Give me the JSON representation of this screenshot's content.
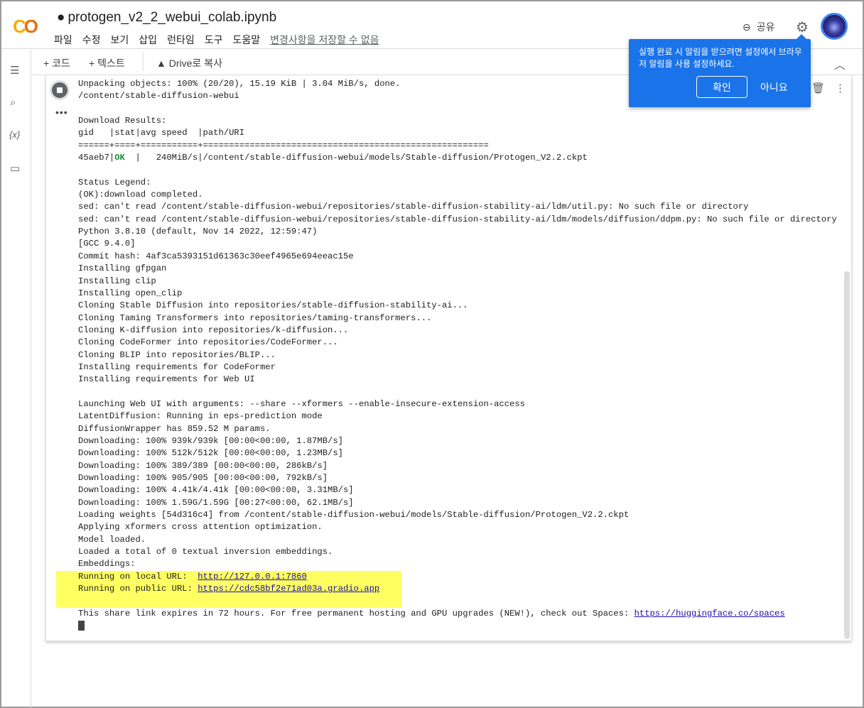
{
  "header": {
    "logo": "CO",
    "title": "protogen_v2_2_webui_colab.ipynb",
    "menu": [
      "파일",
      "수정",
      "보기",
      "삽입",
      "런타임",
      "도구",
      "도움말"
    ],
    "save_status": "변경사항을 저장할 수 없음",
    "share": "공유"
  },
  "toolbar": {
    "add_code": "+ 코드",
    "add_text": "+ 텍스트",
    "copy_drive": "Drive로 복사"
  },
  "popup": {
    "message": "실행 완료 시 알림을 받으려면 설정에서 브라우저 알림을 사용 설정하세요.",
    "confirm": "확인",
    "decline": "아니요"
  },
  "output": {
    "lines_a": [
      "Unpacking objects: 100% (20/20), 15.19 KiB | 3.04 MiB/s, done.",
      "/content/stable-diffusion-webui",
      "",
      "Download Results:",
      "gid   |stat|avg speed  |path/URI",
      "======+====+===========+======================================================="
    ],
    "row_gid": "45aeb7|",
    "row_ok": "OK",
    "row_rest": "  |   240MiB/s|/content/stable-diffusion-webui/models/Stable-diffusion/Protogen_V2.2.ckpt",
    "lines_b": [
      "",
      "Status Legend:",
      "(OK):download completed.",
      "sed: can't read /content/stable-diffusion-webui/repositories/stable-diffusion-stability-ai/ldm/util.py: No such file or directory",
      "sed: can't read /content/stable-diffusion-webui/repositories/stable-diffusion-stability-ai/ldm/models/diffusion/ddpm.py: No such file or directory",
      "Python 3.8.10 (default, Nov 14 2022, 12:59:47)",
      "[GCC 9.4.0]",
      "Commit hash: 4af3ca5393151d61363c30eef4965e694eeac15e",
      "Installing gfpgan",
      "Installing clip",
      "Installing open_clip",
      "Cloning Stable Diffusion into repositories/stable-diffusion-stability-ai...",
      "Cloning Taming Transformers into repositories/taming-transformers...",
      "Cloning K-diffusion into repositories/k-diffusion...",
      "Cloning CodeFormer into repositories/CodeFormer...",
      "Cloning BLIP into repositories/BLIP...",
      "Installing requirements for CodeFormer",
      "Installing requirements for Web UI",
      "",
      "Launching Web UI with arguments: --share --xformers --enable-insecure-extension-access",
      "LatentDiffusion: Running in eps-prediction mode",
      "DiffusionWrapper has 859.52 M params.",
      "Downloading: 100% 939k/939k [00:00<00:00, 1.87MB/s]",
      "Downloading: 100% 512k/512k [00:00<00:00, 1.23MB/s]",
      "Downloading: 100% 389/389 [00:00<00:00, 286kB/s]",
      "Downloading: 100% 905/905 [00:00<00:00, 792kB/s]",
      "Downloading: 100% 4.41k/4.41k [00:00<00:00, 3.31MB/s]",
      "Downloading: 100% 1.59G/1.59G [00:27<00:00, 62.1MB/s]",
      "Loading weights [54d316c4] from /content/stable-diffusion-webui/models/Stable-diffusion/Protogen_V2.2.ckpt",
      "Applying xformers cross attention optimization.",
      "Model loaded.",
      "Loaded a total of 0 textual inversion embeddings.",
      "Embeddings:"
    ],
    "local_label": "Running on local URL:  ",
    "local_url": "http://127.0.0.1:7860",
    "public_label": "Running on public URL: ",
    "public_url": "https://cdc58bf2e71ad03a.gradio.app",
    "share_text": "This share link expires in 72 hours. For free permanent hosting and GPU upgrades (NEW!), check out Spaces: ",
    "share_url": "https://huggingface.co/spaces"
  },
  "colors": {
    "popup": "#1a73e8",
    "highlight": "#ffff62",
    "ok": "#1e8e3e",
    "logo_orange": "#f9ab00"
  }
}
